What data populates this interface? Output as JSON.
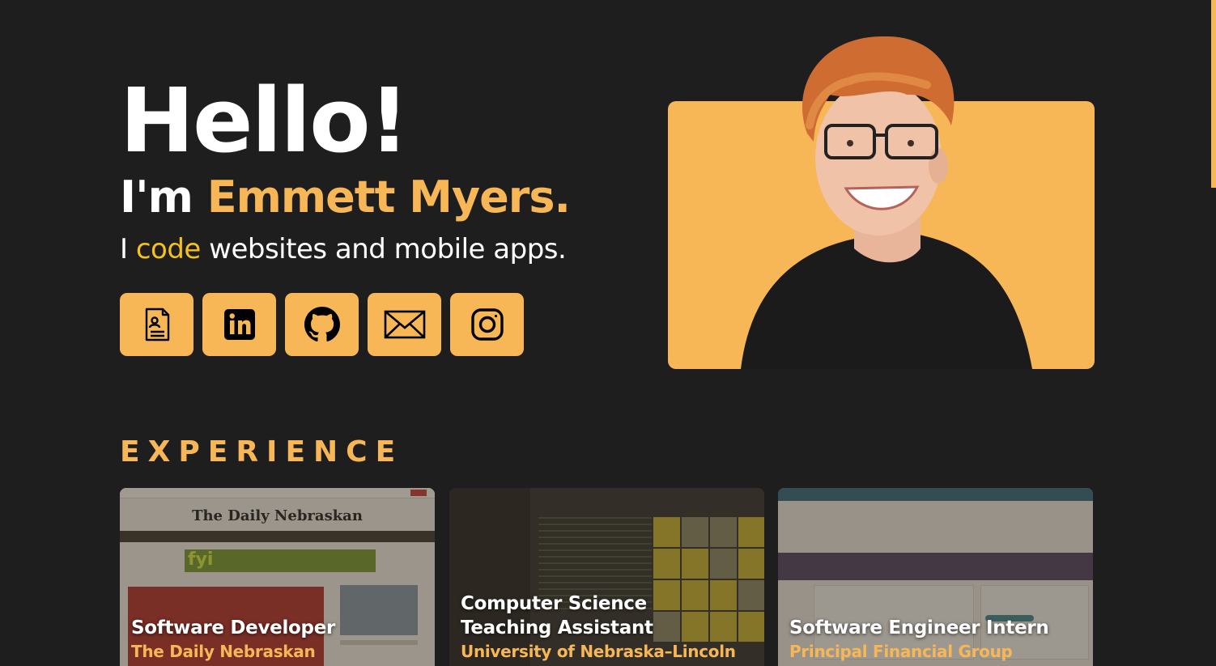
{
  "hero": {
    "greeting": "Hello!",
    "intro_prefix": "I'm ",
    "name": "Emmett Myers.",
    "tagline_prefix": "I ",
    "tagline_verb": "code",
    "tagline_suffix": " websites and mobile apps.",
    "social_links": [
      {
        "icon": "resume-icon"
      },
      {
        "icon": "linkedin-icon"
      },
      {
        "icon": "github-icon"
      },
      {
        "icon": "email-icon"
      },
      {
        "icon": "instagram-icon"
      }
    ]
  },
  "experience": {
    "title": "EXPERIENCE",
    "cards": [
      {
        "title": "Software Developer",
        "company": "The Daily Nebraskan",
        "thumb_logo": "The Daily Nebraskan",
        "thumb_ad": "fyi"
      },
      {
        "title_line1": "Computer Science",
        "title_line2": "Teaching Assistant",
        "company": "University of Nebraska–Lincoln"
      },
      {
        "title": "Software Engineer Intern",
        "company": "Principal Financial Group"
      }
    ]
  },
  "colors": {
    "background": "#1f1e1f",
    "accent": "#f7b756",
    "code_highlight": "#f4c11d"
  }
}
